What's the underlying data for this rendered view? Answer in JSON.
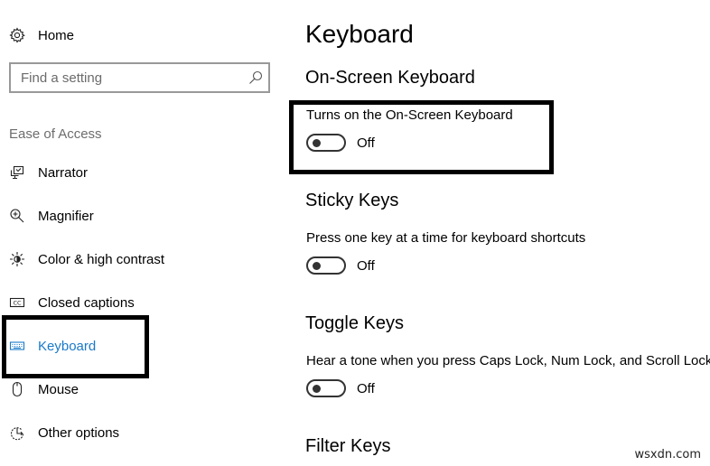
{
  "sidebar": {
    "home": {
      "label": "Home",
      "icon": "gear-icon"
    },
    "search": {
      "placeholder": "Find a setting",
      "value": "",
      "icon": "search-icon"
    },
    "section_label": "Ease of Access",
    "items": [
      {
        "label": "Narrator",
        "icon": "narrator-icon",
        "active": false
      },
      {
        "label": "Magnifier",
        "icon": "magnifier-icon",
        "active": false
      },
      {
        "label": "Color & high contrast",
        "icon": "brightness-icon",
        "active": false
      },
      {
        "label": "Closed captions",
        "icon": "closed-captions-icon",
        "active": false
      },
      {
        "label": "Keyboard",
        "icon": "keyboard-icon",
        "active": true
      },
      {
        "label": "Mouse",
        "icon": "mouse-icon",
        "active": false
      },
      {
        "label": "Other options",
        "icon": "timer-icon",
        "active": false
      }
    ]
  },
  "main": {
    "title": "Keyboard",
    "sections": [
      {
        "title": "On-Screen Keyboard",
        "description": "Turns on the On-Screen Keyboard",
        "toggle_state": "Off",
        "on": false
      },
      {
        "title": "Sticky Keys",
        "description": "Press one key at a time for keyboard shortcuts",
        "toggle_state": "Off",
        "on": false
      },
      {
        "title": "Toggle Keys",
        "description": "Hear a tone when you press Caps Lock, Num Lock, and Scroll Lock",
        "toggle_state": "Off",
        "on": false
      },
      {
        "title": "Filter Keys"
      }
    ]
  },
  "colors": {
    "accent": "#1a79c9",
    "highlight_box": "#000000",
    "secondary_text": "#6d6d6d",
    "search_border": "#999999"
  },
  "watermark": "wsxdn.com"
}
